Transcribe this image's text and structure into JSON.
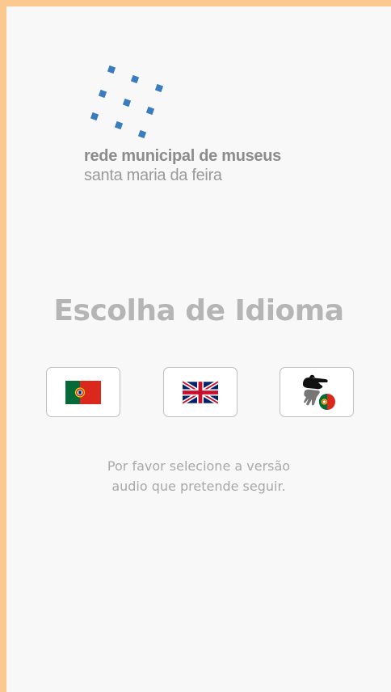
{
  "logo": {
    "line1": "rede municipal de museus",
    "line2": "santa maria da feira",
    "accent_color": "#3a7cc0"
  },
  "title": "Escolha de Idioma",
  "languages": [
    {
      "name": "Português",
      "icon": "portugal-flag-icon"
    },
    {
      "name": "English",
      "icon": "united-kingdom-flag-icon"
    },
    {
      "name": "Língua Gestual Portuguesa",
      "icon": "sign-language-portugal-icon"
    }
  ],
  "hint": {
    "line1": "Por favor selecione a versão",
    "line2": "audio que pretende seguir."
  },
  "colors": {
    "page_border": "#fbc890",
    "background": "#f8f8f8",
    "text_muted": "#b5b5b5"
  }
}
